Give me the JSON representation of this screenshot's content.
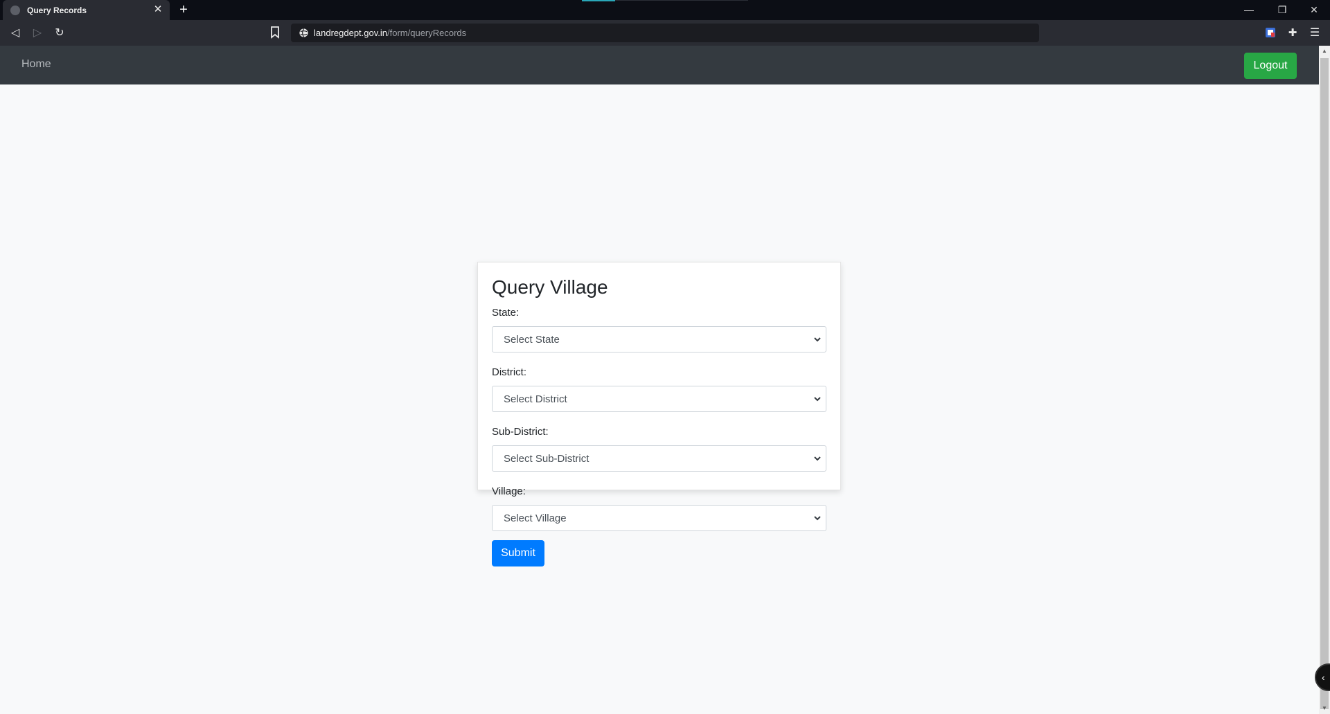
{
  "browser": {
    "tab_title": "Query Records",
    "tab_close": "✕",
    "new_tab": "+",
    "url_host": "landregdept.gov.in",
    "url_path": "/form/queryRecords",
    "window_controls": {
      "minimize": "—",
      "restore": "❐",
      "close": "✕"
    },
    "toolbar": {
      "back": "◁",
      "forward": "▷",
      "reload": "↻",
      "extensions": "✚",
      "menu": "☰"
    }
  },
  "navbar": {
    "home_label": "Home",
    "logout_label": "Logout"
  },
  "form": {
    "title": "Query Village",
    "fields": [
      {
        "label": "State:",
        "value": "Select State"
      },
      {
        "label": "District:",
        "value": "Select District"
      },
      {
        "label": "Sub-District:",
        "value": "Select Sub-District"
      },
      {
        "label": "Village:",
        "value": "Select Village"
      }
    ],
    "submit_label": "Submit"
  },
  "colors": {
    "navbar_bg": "#343a40",
    "logout_bg": "#28a745",
    "submit_bg": "#007bff",
    "page_bg": "#f8f9fa"
  }
}
